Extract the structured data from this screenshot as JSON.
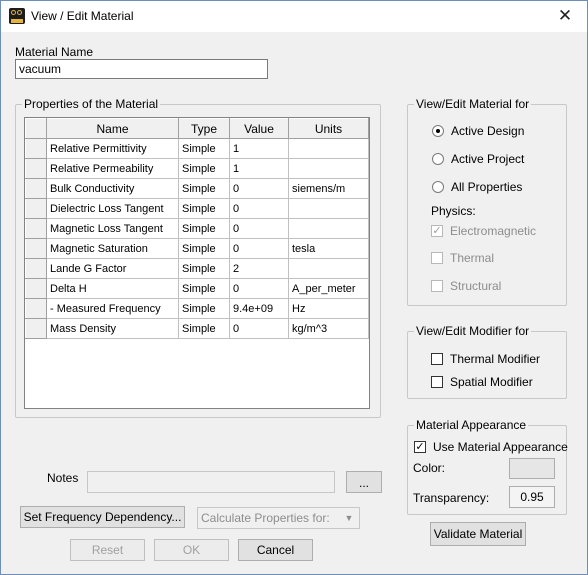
{
  "window": {
    "title": "View / Edit Material",
    "close_glyph": "✕"
  },
  "material_name": {
    "label": "Material Name",
    "value": "vacuum"
  },
  "properties": {
    "group_label": "Properties of the Material",
    "columns": [
      "Name",
      "Type",
      "Value",
      "Units"
    ],
    "rows": [
      {
        "name": "Relative Permittivity",
        "type": "Simple",
        "value": "1",
        "units": ""
      },
      {
        "name": "Relative Permeability",
        "type": "Simple",
        "value": "1",
        "units": ""
      },
      {
        "name": "Bulk Conductivity",
        "type": "Simple",
        "value": "0",
        "units": "siemens/m"
      },
      {
        "name": "Dielectric Loss Tangent",
        "type": "Simple",
        "value": "0",
        "units": ""
      },
      {
        "name": "Magnetic Loss Tangent",
        "type": "Simple",
        "value": "0",
        "units": ""
      },
      {
        "name": "Magnetic Saturation",
        "type": "Simple",
        "value": "0",
        "units": "tesla"
      },
      {
        "name": "Lande G Factor",
        "type": "Simple",
        "value": "2",
        "units": ""
      },
      {
        "name": "Delta H",
        "type": "Simple",
        "value": "0",
        "units": "A_per_meter"
      },
      {
        "name": "- Measured Frequency",
        "type": "Simple",
        "value": "9.4e+09",
        "units": "Hz"
      },
      {
        "name": "Mass Density",
        "type": "Simple",
        "value": "0",
        "units": "kg/m^3"
      }
    ]
  },
  "view_edit_for": {
    "group_label": "View/Edit Material for",
    "options": [
      {
        "label": "Active Design",
        "selected": true
      },
      {
        "label": "Active Project",
        "selected": false
      },
      {
        "label": "All Properties",
        "selected": false
      }
    ],
    "physics_label": "Physics:",
    "physics": [
      {
        "label": "Electromagnetic",
        "checked": true,
        "enabled": false
      },
      {
        "label": "Thermal",
        "checked": false,
        "enabled": false
      },
      {
        "label": "Structural",
        "checked": false,
        "enabled": false
      }
    ]
  },
  "modifier": {
    "group_label": "View/Edit Modifier for",
    "thermal_label": "Thermal Modifier",
    "spatial_label": "Spatial Modifier"
  },
  "appearance": {
    "group_label": "Material Appearance",
    "use_label": "Use Material Appearance",
    "use_checked": true,
    "color_label": "Color:",
    "color_value": "#e6e6e6",
    "transparency_label": "Transparency:",
    "transparency_value": "0.95"
  },
  "validate_label": "Validate Material",
  "notes": {
    "label": "Notes",
    "value": "",
    "browse_label": "..."
  },
  "freq_dependency_label": "Set Frequency Dependency...",
  "calc_props": {
    "placeholder": "Calculate Properties for:"
  },
  "buttons": {
    "reset": "Reset",
    "ok": "OK",
    "cancel": "Cancel"
  }
}
